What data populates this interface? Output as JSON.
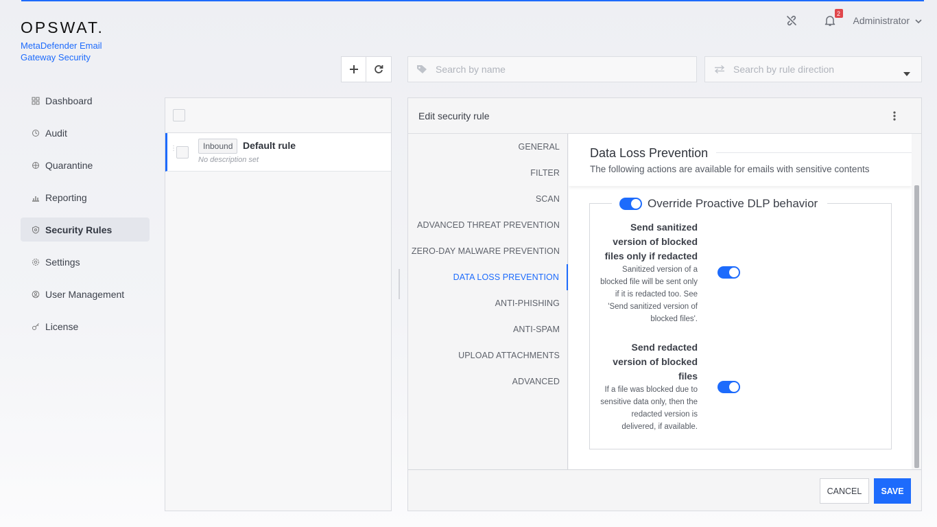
{
  "brand": {
    "logo": "OPSWAT.",
    "product": "MetaDefender Email Gateway Security"
  },
  "header": {
    "notification_count": "2",
    "user": "Administrator"
  },
  "sidebar": {
    "items": [
      {
        "label": "Dashboard",
        "icon": "dashboard-icon"
      },
      {
        "label": "Audit",
        "icon": "audit-icon"
      },
      {
        "label": "Quarantine",
        "icon": "quarantine-icon"
      },
      {
        "label": "Reporting",
        "icon": "reporting-icon"
      },
      {
        "label": "Security Rules",
        "icon": "shield-icon",
        "active": true
      },
      {
        "label": "Settings",
        "icon": "gear-icon"
      },
      {
        "label": "User Management",
        "icon": "user-icon"
      },
      {
        "label": "License",
        "icon": "license-icon"
      }
    ]
  },
  "toolbar": {
    "search_placeholder": "Search by name",
    "direction_placeholder": "Search by rule direction"
  },
  "rules": [
    {
      "direction": "Inbound",
      "name": "Default rule",
      "description": "No description set"
    }
  ],
  "editor": {
    "title": "Edit security rule",
    "tabs": [
      "GENERAL",
      "FILTER",
      "SCAN",
      "ADVANCED THREAT PREVENTION",
      "ZERO-DAY MALWARE PREVENTION",
      "DATA LOSS PREVENTION",
      "ANTI-PHISHING",
      "ANTI-SPAM",
      "UPLOAD ATTACHMENTS",
      "ADVANCED"
    ],
    "active_tab": "DATA LOSS PREVENTION",
    "section_title": "Data Loss Prevention",
    "section_subtitle": "The following actions are available for emails with sensitive contents",
    "override_label": "Override Proactive DLP behavior",
    "override_enabled": true,
    "options": [
      {
        "title": "Send sanitized version of blocked files only if redacted",
        "description": "Sanitized version of a blocked file will be sent only if it is redacted too. See 'Send sanitized version of blocked files'.",
        "enabled": true
      },
      {
        "title": "Send redacted version of blocked files",
        "description": "If a file was blocked due to sensitive data only, then the redacted version is delivered, if available.",
        "enabled": true
      }
    ],
    "cancel_label": "CANCEL",
    "save_label": "SAVE"
  },
  "colors": {
    "accent": "#1d6bfc",
    "badge": "#e0474c"
  }
}
